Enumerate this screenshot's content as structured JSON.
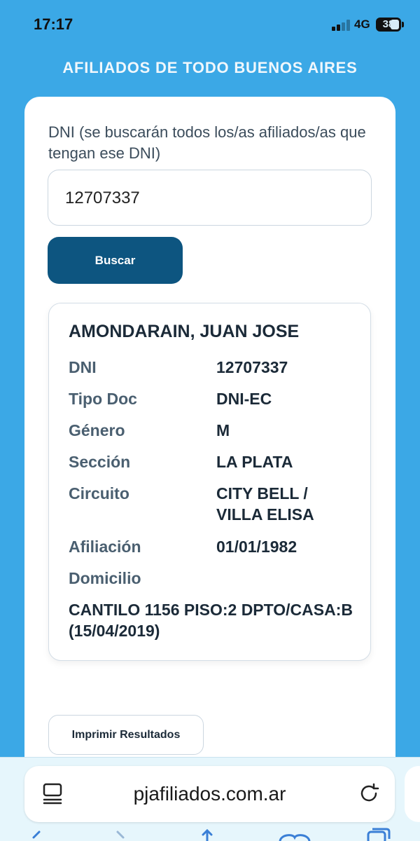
{
  "status_bar": {
    "time": "17:17",
    "network": "4G",
    "battery": "38"
  },
  "app_title": "AFILIADOS DE TODO BUENOS AIRES",
  "search": {
    "label": "DNI (se buscarán todos los/as afiliados/as que tengan ese DNI)",
    "value": "12707337",
    "button_label": "Buscar"
  },
  "result": {
    "name": "AMONDARAIN, JUAN JOSE",
    "fields": [
      {
        "label": "DNI",
        "value": "12707337"
      },
      {
        "label": "Tipo Doc",
        "value": "DNI-EC"
      },
      {
        "label": "Género",
        "value": "M"
      },
      {
        "label": "Sección",
        "value": "LA PLATA"
      },
      {
        "label": "Circuito",
        "value": "CITY BELL / VILLA ELISA"
      },
      {
        "label": "Afiliación",
        "value": "01/01/1982"
      },
      {
        "label": "Domicilio",
        "value": "CANTILO 1156 PISO:2 DPTO/CASA:B (15/04/2019)"
      }
    ]
  },
  "print_button_label": "Imprimir Resultados",
  "browser": {
    "url": "pjafiliados.com.ar",
    "tabs_icon": "tabs-icon",
    "reload_icon": "reload-icon"
  },
  "colors": {
    "background": "#3ba8e6",
    "primary_button": "#0d5580",
    "card": "#ffffff"
  }
}
